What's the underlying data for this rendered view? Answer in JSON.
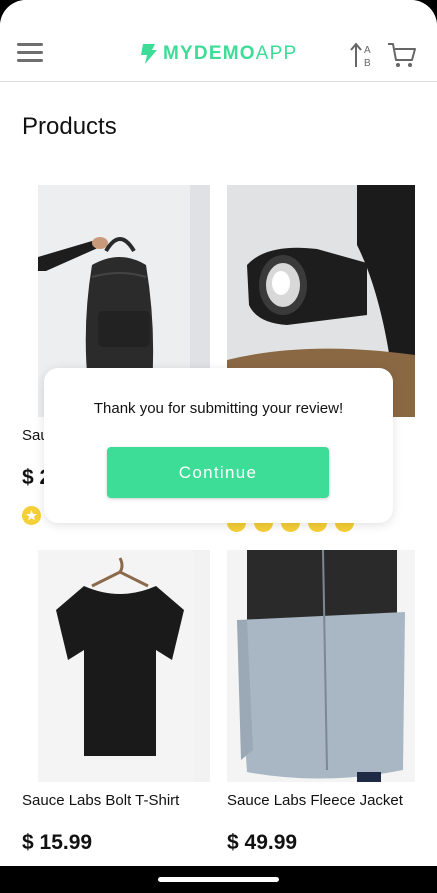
{
  "header": {
    "logo_text_bold": "MYDEMO",
    "logo_text_light": "APP",
    "brand_color": "#3ddc97"
  },
  "page": {
    "title": "Products"
  },
  "products": [
    {
      "name": "Sau",
      "price": "$ 2",
      "rating": 1,
      "image": "backpack"
    },
    {
      "name": "",
      "price": "",
      "rating": 5,
      "image": "bike-light"
    },
    {
      "name": "Sauce Labs Bolt T-Shirt",
      "price": "$ 15.99",
      "image": "t-shirt"
    },
    {
      "name": "Sauce Labs Fleece Jacket",
      "price": "$ 49.99",
      "image": "fleece-jacket"
    }
  ],
  "modal": {
    "message": "Thank you for submitting your review!",
    "button_label": "Continue"
  }
}
